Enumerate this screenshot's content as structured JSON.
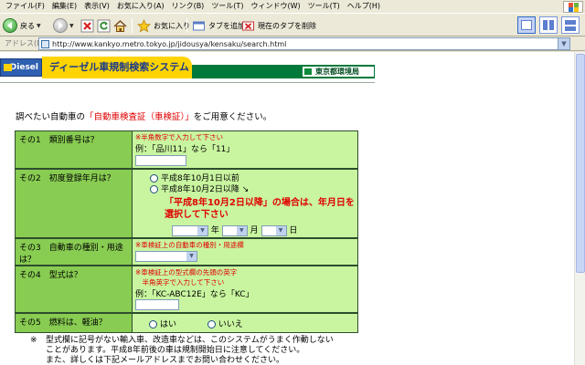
{
  "menu": [
    "ファイル(F)",
    "編集(E)",
    "表示(V)",
    "お気に入り(A)",
    "リンク(B)",
    "ツール(T)",
    "ウィンドウ(W)",
    "ツール(T)",
    "ヘルプ(H)"
  ],
  "toolbar": {
    "back_label": "戻る",
    "favorites_label": "お気に入り",
    "add_tab_label": "タブを追加",
    "delete_tab_label": "現在のタブを削除"
  },
  "address": {
    "label": "アドレス(D)",
    "url": "http://www.kankyo.metro.tokyo.jp/jidousya/kensaku/search.html"
  },
  "banner": {
    "logo_text": "Diesel",
    "title": "ディーゼル車規制検索システム",
    "org": "東京都環境局"
  },
  "intro": {
    "prefix": "調べたい自動車の",
    "highlight": "「自動車検査証（車検証）」",
    "suffix": "をご用意ください。"
  },
  "form": {
    "row1": {
      "label": "その1　類別番号は？",
      "note": "※半角数字で入力して下さい",
      "example": "例：「品川11」なら「11」",
      "value": ""
    },
    "row2": {
      "label": "その2　初度登録年月は？",
      "option1": "平成8年10月1日以前",
      "option2": "平成8年10月2日以降",
      "warning": "「平成8年10月2日以降」の場合は、年月日を選択して下さい",
      "year_unit": "年",
      "month_unit": "月",
      "day_unit": "日"
    },
    "row3": {
      "label": "その3　自動車の種別・用途は？",
      "note": "※車検証上の自動車の種別・用途欄"
    },
    "row4": {
      "label": "その4　型式は？",
      "note1": "※車検証上の型式欄の先頭の英字",
      "note2": "　半角英字で入力して下さい",
      "example": "例：「KC-ABC12E」なら「KC」"
    },
    "row5": {
      "label": "その5　燃料は、軽油？",
      "yes": "はい",
      "no": "いいえ"
    }
  },
  "footnote": {
    "mark": "※",
    "line1": "型式欄に記号がない輸入車、改造車などは、このシステムがうまく作動しない",
    "line2": "ことがあります。平成8年前後の車は規制開始日に注意してください。",
    "line3": "また、詳しくは下記メールアドレスまでお問い合わせください。"
  }
}
